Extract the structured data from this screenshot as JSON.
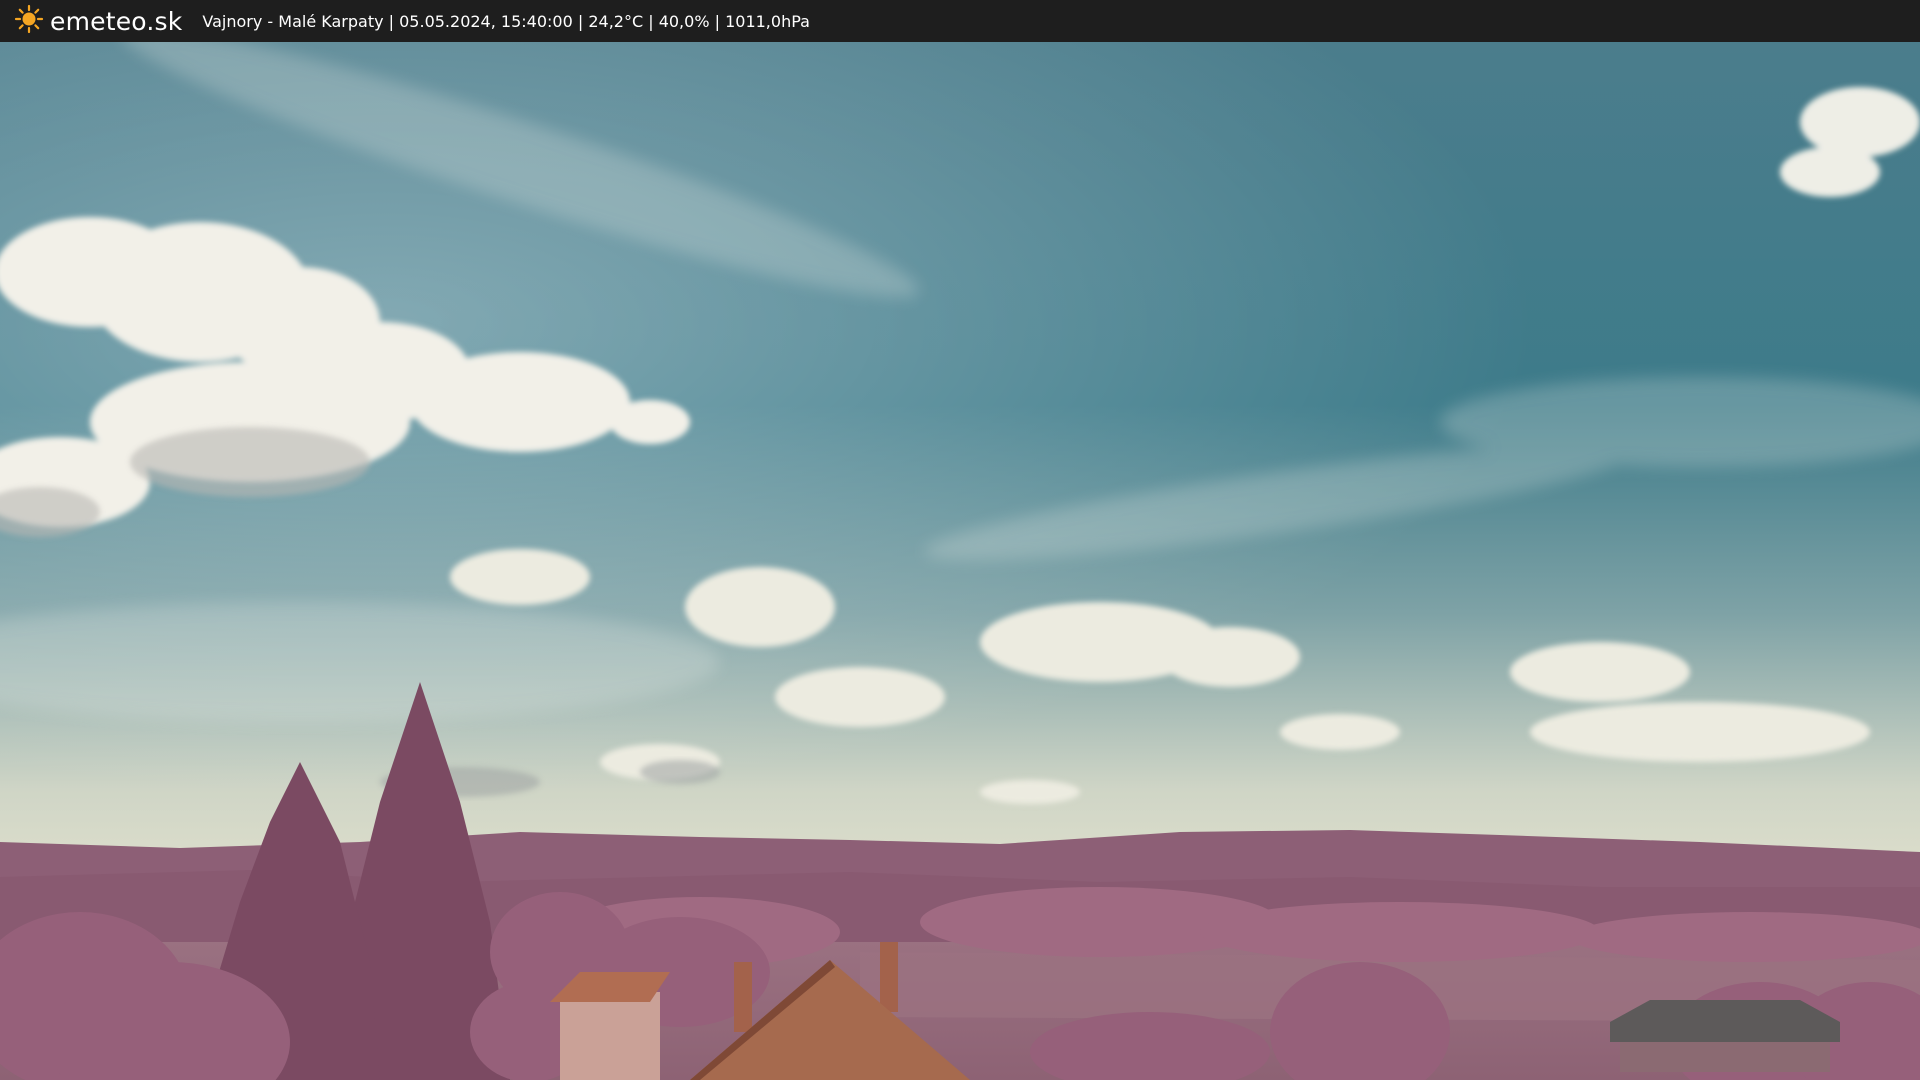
{
  "header": {
    "brand": "emeteo.sk",
    "logo_icon": "sun-icon",
    "caption": "Vajnory - Malé Karpaty | 05.05.2024, 15:40:00 | 24,2°C | 40,0% | 1011,0hPa"
  },
  "colors": {
    "topbar_bg": "#1e1e1e",
    "sun": "#f5a623",
    "sky_top": "#3f7a8a",
    "sky_horizon": "#e5e4cf",
    "hills": "#8f5e76",
    "foliage": "#a56c86",
    "roof": "#a66a4e"
  }
}
